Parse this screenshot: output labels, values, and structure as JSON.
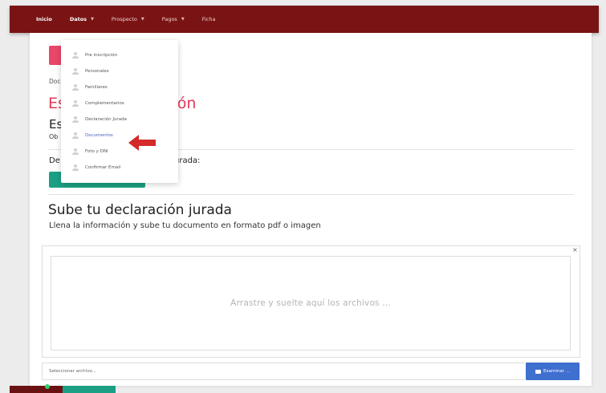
{
  "navbar": {
    "items": [
      {
        "label": "Inicio"
      },
      {
        "label": "Datos"
      },
      {
        "label": "Prospecto"
      },
      {
        "label": "Pagos"
      },
      {
        "label": "Ficha"
      }
    ]
  },
  "dropdown": {
    "items": [
      {
        "label": "Pre inscripción"
      },
      {
        "label": "Personales"
      },
      {
        "label": "Familiares"
      },
      {
        "label": "Complementarios"
      },
      {
        "label": "Declaración Jurada"
      },
      {
        "label": "Documentos"
      },
      {
        "label": "Foto y DNI"
      },
      {
        "label": "Confirmar Email"
      }
    ],
    "active_item": "Documentos"
  },
  "content": {
    "breadcrumb_partial": "Doc",
    "headline_red_left": "Es",
    "headline_red_right": "ción",
    "headline_dark_partial": "Es",
    "subtitle_partial": "Ob",
    "declaration_left": "De",
    "declaration_right": "urada:",
    "section_title": "Sube tu declaración jurada",
    "section_subtitle": "Llena la información y sube tu documento en formato pdf o imagen"
  },
  "upload": {
    "close_glyph": "×",
    "drop_text": "Arrastre y suelte aquí los archivos ...",
    "file_placeholder": "Seleccionar archivo...",
    "browse_label": "Examinar ..."
  },
  "colors": {
    "navbar": "#7a1414",
    "accent_red": "#e23a5b",
    "green": "#1ba085",
    "primary_blue": "#3f6fcf",
    "annotation_arrow": "#d42a2a"
  }
}
